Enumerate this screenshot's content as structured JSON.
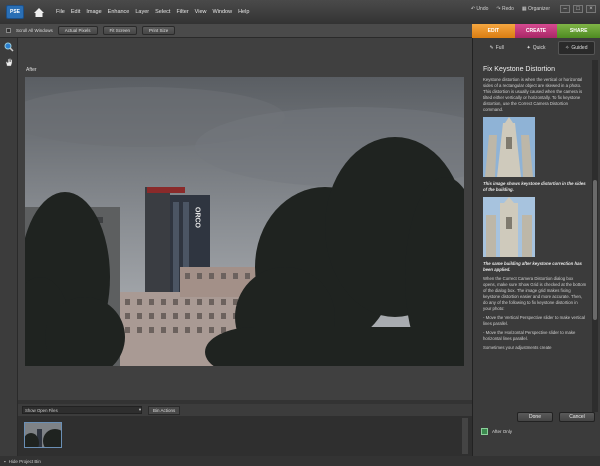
{
  "app": {
    "logo_text": "PSE"
  },
  "menu": [
    "File",
    "Edit",
    "Image",
    "Enhance",
    "Layer",
    "Select",
    "Filter",
    "View",
    "Window",
    "Help"
  ],
  "toolbar_right": {
    "undo": "Undo",
    "redo": "Redo",
    "organizer": "Organizer"
  },
  "options_bar": {
    "scroll_all_windows": "Scroll All Windows",
    "actual_pixels": "Actual Pixels",
    "fit_screen": "Fit Screen",
    "print_size": "Print Size"
  },
  "top_tabs": {
    "edit": "EDIT",
    "create": "CREATE",
    "share": "SHARE"
  },
  "edit_modes": {
    "full": "Full",
    "quick": "Quick",
    "guided": "Guided"
  },
  "document": {
    "title": "After",
    "building_sign": "ORCO"
  },
  "bin": {
    "select_value": "Show Open Files",
    "bin_actions": "Bin Actions",
    "hide_project_bin": "Hide Project Bin"
  },
  "guide": {
    "title": "Fix Keystone Distortion",
    "intro": "Keystone distortion is when the vertical or horizontal sides of a rectangular object are skewed in a photo. This distortion is usually caused when the camera is tilted either vertically or horizontally. To fix keystone distortion, use the Correct Camera Distortion command.",
    "caption1": "This image shows keystone distortion in the sides of the building.",
    "caption2": "The same building after keystone correction has been applied.",
    "body": "When the Correct Camera Distortion dialog box opens, make sure Show Grid is checked at the bottom of the dialog box. The image grid makes fixing keystone distortion easier and more accurate. Then, do any of the following to fix keystone distortion in your photo:",
    "step1": "- Move the Vertical Perspective slider to make vertical lines parallel.",
    "step2": "- Move the Horizontal Perspective slider to make horizontal lines parallel.",
    "more": "Sometimes your adjustments create"
  },
  "panel_buttons": {
    "done": "Done",
    "cancel": "Cancel"
  },
  "after_only": "After Only"
}
